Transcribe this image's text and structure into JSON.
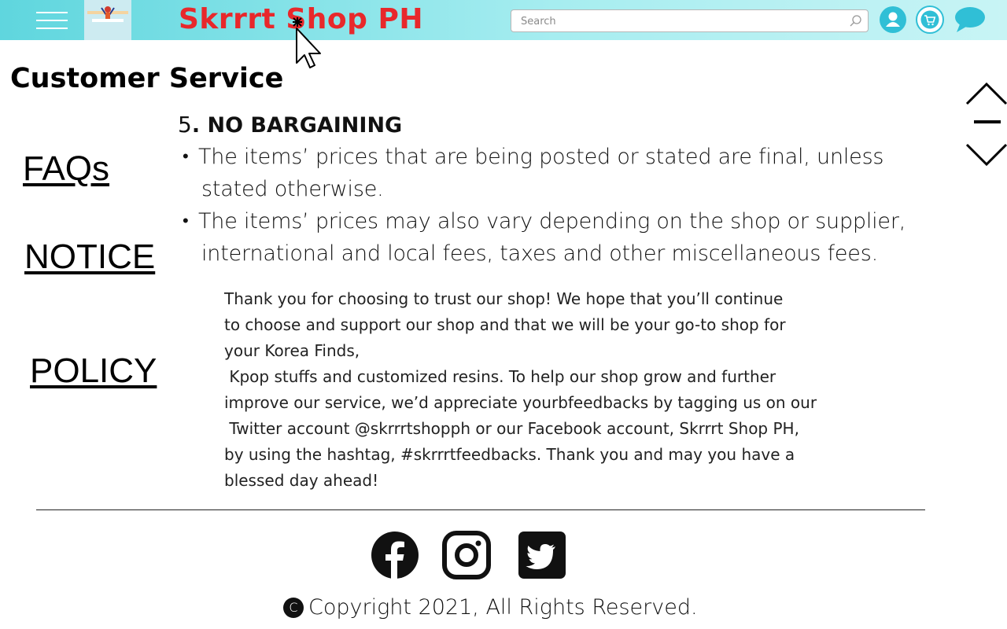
{
  "header": {
    "brand": "Skrrrt Shop PH",
    "search_placeholder": "Search",
    "menu_icon": "hamburger-icon",
    "icons": [
      "user-icon",
      "cart-icon",
      "chat-icon"
    ],
    "colors": {
      "bar_start": "#5fd6de",
      "bar_end": "#c8f4f5",
      "brand": "#e8282b",
      "icon_circle": "#30bfd6"
    }
  },
  "page": {
    "title": "Customer Service"
  },
  "sidebar": {
    "links": [
      {
        "label": "FAQs"
      },
      {
        "label": "NOTICE"
      },
      {
        "label": "POLICY"
      }
    ]
  },
  "policy": {
    "number": "5",
    "heading": ". NO BARGAINING",
    "bullets": [
      {
        "line1": "The items’ prices that are being posted or stated are final, unless",
        "line2": "stated otherwise."
      },
      {
        "line1": "The items’ prices may also vary depending on the shop or supplier,",
        "line2": "international and local fees, taxes and other miscellaneous fees."
      }
    ],
    "bullet_char": "•"
  },
  "thanks": {
    "lines": [
      "Thank you for choosing to trust our shop! We hope that you’ll continue",
      "to choose and support our shop and that we will be your go-to shop for",
      "your Korea Finds,",
      " Kpop stuffs and customized resins. To help our shop grow and further",
      "improve our service, we’d appreciate yourbfeedbacks by tagging us on our",
      " Twitter account @skrrrtshopph or our Facebook account, Skrrrt Shop PH,",
      "by using the hashtag, #skrrrtfeedbacks. Thank you and may you have a",
      "blessed day ahead!"
    ]
  },
  "footer": {
    "social": [
      "facebook-icon",
      "instagram-icon",
      "twitter-icon"
    ],
    "copyright_symbol": "C",
    "copyright": "Copyright 2021, All Rights Reserved."
  },
  "scroll_controls": [
    "chevron-up-icon",
    "minus-icon",
    "chevron-down-icon"
  ]
}
